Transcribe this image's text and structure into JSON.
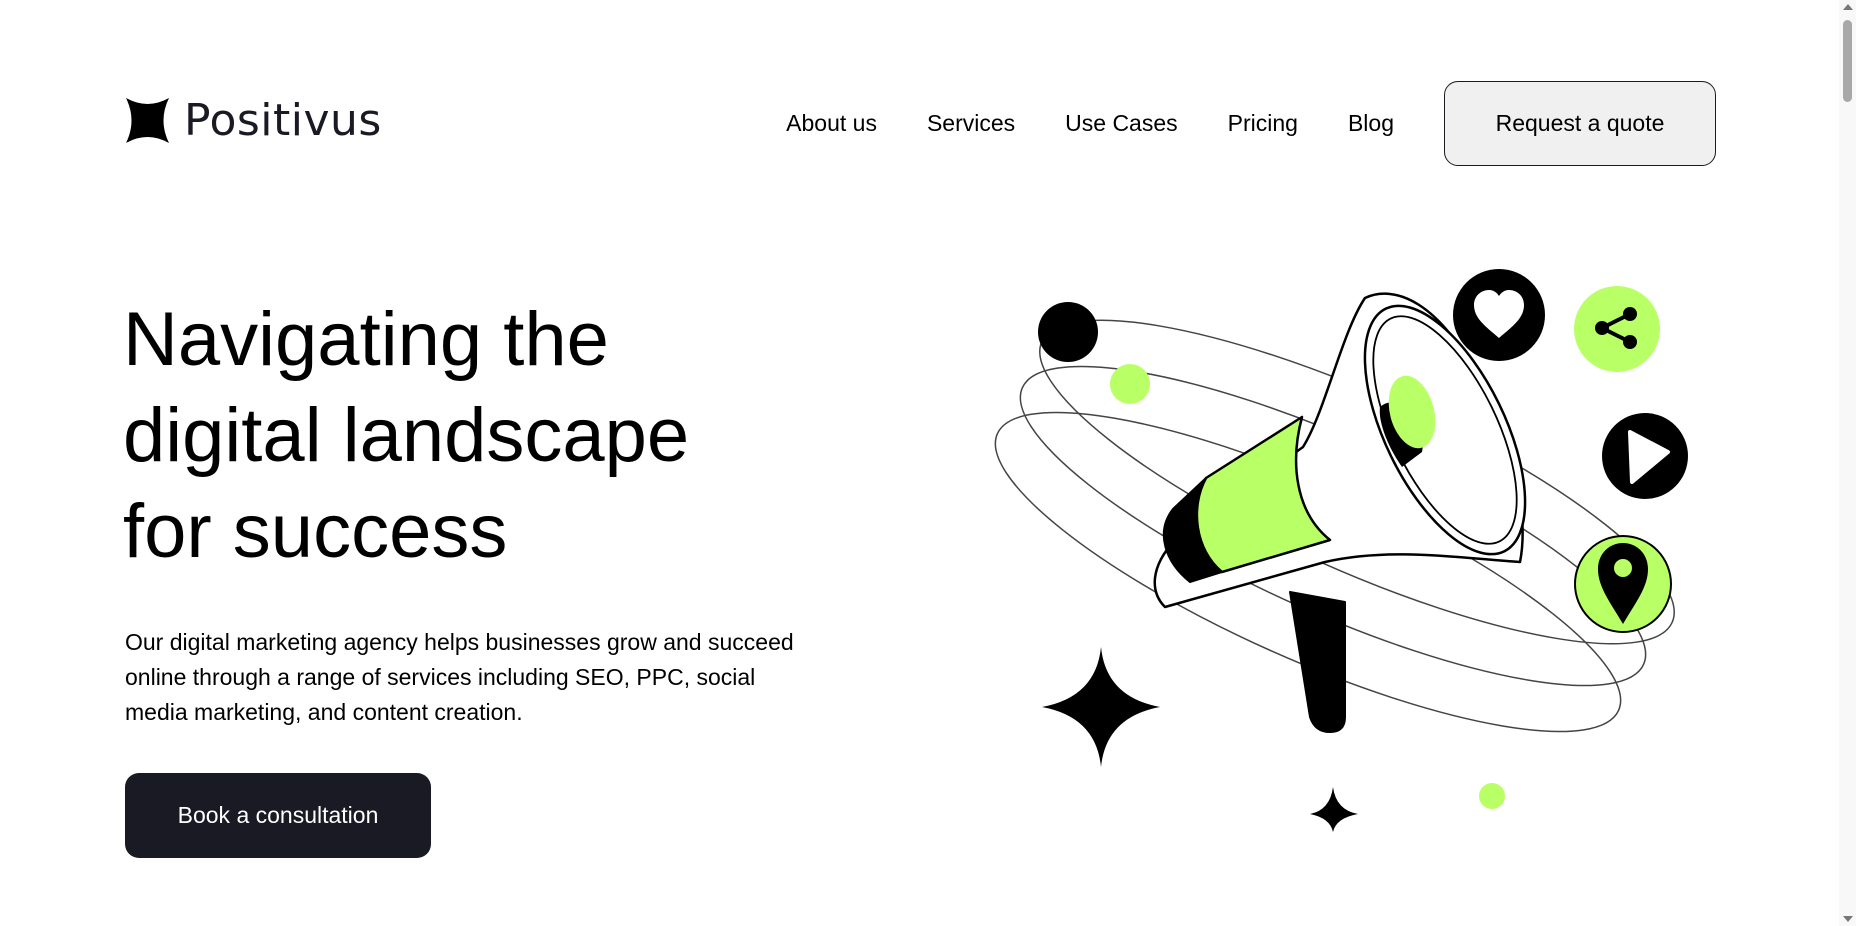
{
  "brand": {
    "name": "Positivus",
    "logo_icon": "star-burst-icon"
  },
  "nav": {
    "items": [
      {
        "label": "About us"
      },
      {
        "label": "Services"
      },
      {
        "label": "Use Cases"
      },
      {
        "label": "Pricing"
      },
      {
        "label": "Blog"
      }
    ],
    "quote_button": "Request a quote"
  },
  "hero": {
    "title_lines": [
      "Navigating the",
      "digital landscape",
      "for success"
    ],
    "description": "Our digital marketing agency helps businesses grow and succeed online through a range of services including SEO, PPC, social media marketing, and content creation.",
    "cta_label": "Book a consultation"
  },
  "illustration": {
    "subject": "megaphone-icon",
    "icons": [
      "heart-icon",
      "share-icon",
      "play-icon",
      "location-pin-icon",
      "sparkle-icon"
    ]
  },
  "colors": {
    "accent": "#b9ff66",
    "dark": "#191a23",
    "light": "#f0f0f0"
  }
}
